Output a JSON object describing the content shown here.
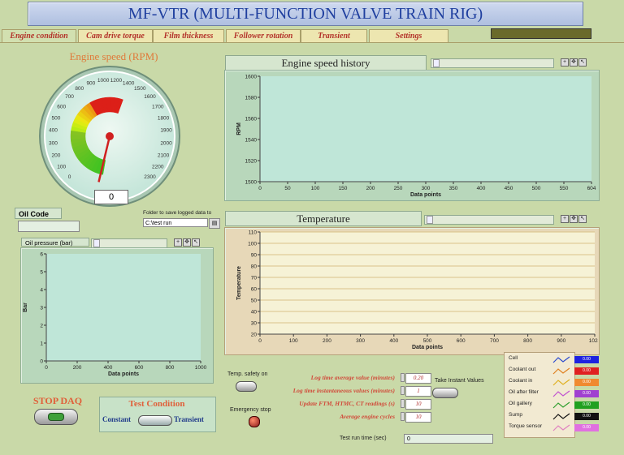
{
  "app": {
    "title": "MF-VTR (MULTI-FUNCTION VALVE TRAIN RIG)"
  },
  "tabs": [
    {
      "label": "Engine condition",
      "active": true
    },
    {
      "label": "Cam drive torque",
      "active": false
    },
    {
      "label": "Film thickness",
      "active": false
    },
    {
      "label": "Follower rotation",
      "active": false
    },
    {
      "label": "Transient",
      "active": false
    },
    {
      "label": "Settings",
      "active": false
    }
  ],
  "gauge": {
    "title": "Engine speed (RPM)",
    "ticks": [
      "0",
      "100",
      "200",
      "300",
      "400",
      "500",
      "600",
      "700",
      "800",
      "900",
      "1000",
      "1200",
      "1400",
      "1500",
      "1600",
      "1700",
      "1800",
      "1900",
      "2000",
      "2100",
      "2200",
      "2300"
    ],
    "max": 2300,
    "value": 0,
    "readout": "0"
  },
  "oil_code": {
    "label": "Oil Code",
    "value": ""
  },
  "folder": {
    "label": "Folder to save logged data to",
    "value": "C:\\test run"
  },
  "engine_speed_chart": {
    "title": "Engine speed history",
    "ylabel": "RPM",
    "xlabel": "Data points",
    "yticks": [
      "1600",
      "1580",
      "1560",
      "1540",
      "1520",
      "1500"
    ],
    "xticks": [
      "0",
      "50",
      "100",
      "150",
      "200",
      "250",
      "300",
      "350",
      "400",
      "450",
      "500",
      "550",
      "604"
    ]
  },
  "temperature_chart": {
    "title": "Temperature",
    "ylabel": "Temperature",
    "xlabel": "Data points",
    "yticks": [
      "110",
      "100",
      "90",
      "80",
      "70",
      "60",
      "50",
      "40",
      "30",
      "20"
    ],
    "xticks": [
      "0",
      "100",
      "200",
      "300",
      "400",
      "500",
      "600",
      "700",
      "800",
      "900",
      "1024"
    ]
  },
  "oil_pressure_chart": {
    "title": "Oil pressure (bar)",
    "ylabel": "Bar",
    "xlabel": "Data points",
    "yticks": [
      "6",
      "5",
      "4",
      "3",
      "2",
      "1",
      "0"
    ],
    "xticks": [
      "0",
      "200",
      "400",
      "600",
      "800",
      "1000"
    ]
  },
  "controls": {
    "stop_daq": "STOP DAQ",
    "test_condition": "Test Condition",
    "constant": "Constant",
    "transient": "Transient",
    "temp_safety": "Temp. safety on",
    "emergency_stop": "Emergency stop",
    "take_instant": "Take Instant Values",
    "test_run_time_label": "Test run time (sec)",
    "test_run_time_value": "0"
  },
  "settings_fields": [
    {
      "label": "Log time average value (minutes)",
      "value": "0.20"
    },
    {
      "label": "Log time instantaneous values (minutes)",
      "value": "1"
    },
    {
      "label": "Update FTM, HTMC, CT readings (s)",
      "value": "10"
    },
    {
      "label": "Average engine cycles",
      "value": "10"
    }
  ],
  "legend": [
    {
      "name": "Cell",
      "line": "#2a4ad0",
      "value": "0.00",
      "color": "#1e22e0"
    },
    {
      "name": "Coolant out",
      "line": "#e08020",
      "value": "0.00",
      "color": "#e02020"
    },
    {
      "name": "Coolant in",
      "line": "#e0b020",
      "value": "0.00",
      "color": "#f08a30"
    },
    {
      "name": "Oil after filter",
      "line": "#c050d0",
      "value": "0.00",
      "color": "#a040d0"
    },
    {
      "name": "Oil gallery",
      "line": "#30a030",
      "value": "0.00",
      "color": "#20a020"
    },
    {
      "name": "Sump",
      "line": "#111111",
      "value": "0.00",
      "color": "#111111"
    },
    {
      "name": "Torque sensor",
      "line": "#e080c0",
      "value": "0.00",
      "color": "#e070e0"
    }
  ]
}
